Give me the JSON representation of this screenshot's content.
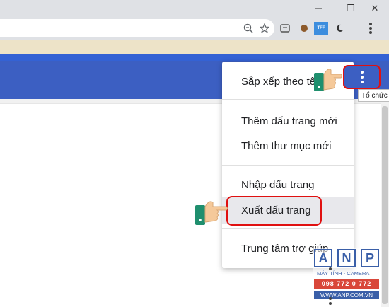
{
  "window": {
    "restore_glyph": "❐",
    "close_glyph": "✕"
  },
  "toolbar": {
    "icons": [
      "zoom-icon",
      "star-icon",
      "extension-icon",
      "cookie-icon",
      "tff-icon",
      "moon-icon",
      "more-icon"
    ],
    "tff_label": "TFF"
  },
  "bookmark_manager": {
    "menu_button_tooltip": "Tổ chức",
    "accent_color": "#3c5fc2"
  },
  "menu": {
    "sort": "Sắp xếp theo tên",
    "add_bookmark": "Thêm dấu trang mới",
    "add_folder": "Thêm thư mục mới",
    "import": "Nhập dấu trang",
    "export": "Xuất dấu trang",
    "help": "Trung tâm trợ giúp"
  },
  "watermark": {
    "letters": [
      "A",
      "N",
      "P"
    ],
    "tagline": "MÁY TÍNH - CAMERA",
    "phone": "098 772 0 772",
    "website": "WWW.ANP.COM.VN"
  },
  "highlight_color": "#e01010"
}
